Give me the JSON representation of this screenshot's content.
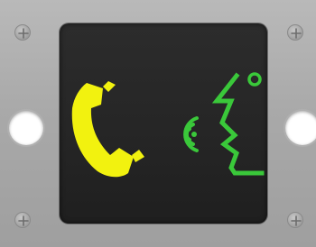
{
  "colors": {
    "plate": "#ababab",
    "panel": "#262626",
    "handset": "#f2f20f",
    "speech": "#3ac83a",
    "hole": "#ffffff"
  },
  "icons": {
    "handset": "telephone-handset-icon",
    "waves": "sound-waves-icon",
    "face": "speaking-face-icon"
  }
}
